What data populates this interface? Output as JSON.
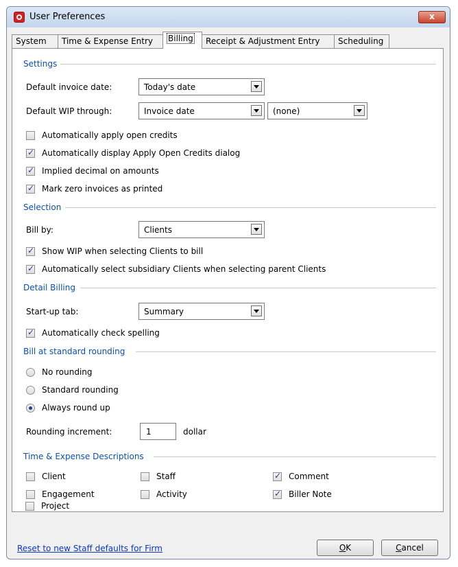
{
  "window": {
    "title": "User Preferences",
    "close_label": "x"
  },
  "tabs": [
    "System",
    "Time & Expense Entry",
    "Billing",
    "Receipt & Adjustment Entry",
    "Scheduling"
  ],
  "settings": {
    "heading": "Settings",
    "invoice_date_label": "Default invoice date:",
    "invoice_date_value": "Today's date",
    "wip_through_label": "Default WIP through:",
    "wip_through_value": "Invoice date",
    "wip_through_secondary": "(none)",
    "options": [
      {
        "label": "Automatically apply open credits",
        "checked": false
      },
      {
        "label": "Automatically display Apply Open Credits dialog",
        "checked": true
      },
      {
        "label": "Implied decimal on amounts",
        "checked": true
      },
      {
        "label": "Mark zero invoices as printed",
        "checked": true
      }
    ]
  },
  "selection": {
    "heading": "Selection",
    "bill_by_label": "Bill by:",
    "bill_by_value": "Clients",
    "options": [
      {
        "label": "Show WIP when selecting Clients to bill",
        "checked": true
      },
      {
        "label": "Automatically select subsidiary Clients when selecting parent Clients",
        "checked": true
      }
    ]
  },
  "detail": {
    "heading": "Detail Billing",
    "startup_label": "Start-up tab:",
    "startup_value": "Summary",
    "spell_label": "Automatically check spelling",
    "spell_checked": true
  },
  "rounding": {
    "heading": "Bill at standard rounding",
    "options": [
      {
        "label": "No rounding",
        "selected": false
      },
      {
        "label": "Standard rounding",
        "selected": false
      },
      {
        "label": "Always round up",
        "selected": true
      }
    ],
    "increment_label": "Rounding increment:",
    "increment_value": "1",
    "increment_unit": "dollar"
  },
  "descriptions": {
    "heading": "Time & Expense Descriptions",
    "items": [
      {
        "label": "Client",
        "checked": false
      },
      {
        "label": "Engagement",
        "checked": false
      },
      {
        "label": "Project",
        "checked": false
      },
      {
        "label": "Staff",
        "checked": false
      },
      {
        "label": "Activity",
        "checked": false
      },
      {
        "label": "Comment",
        "checked": true
      },
      {
        "label": "Biller Note",
        "checked": true
      }
    ]
  },
  "footer": {
    "reset_link": "Reset to new Staff defaults for Firm",
    "ok_underline": "O",
    "ok_rest": "K",
    "cancel_underline": "C",
    "cancel_rest": "ancel"
  }
}
